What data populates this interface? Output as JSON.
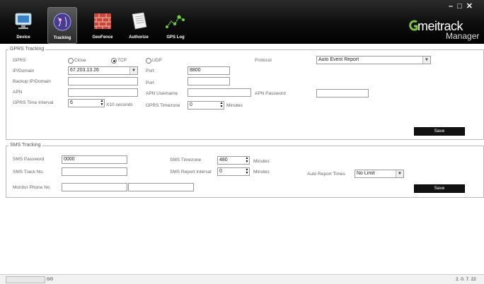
{
  "window": {
    "controls": [
      "–",
      "□",
      "✕"
    ]
  },
  "toolbar": {
    "items": [
      {
        "label": "Device",
        "icon": "monitor-icon"
      },
      {
        "label": "Tracking",
        "icon": "globe-icon",
        "active": true
      },
      {
        "label": "GeoFence",
        "icon": "brick-wall-icon"
      },
      {
        "label": "Authorize",
        "icon": "document-icon"
      },
      {
        "label": "GPS Log",
        "icon": "route-icon"
      }
    ]
  },
  "brand": {
    "name": "meitrack",
    "sub": "Manager",
    "color": "#7ec242"
  },
  "gprs": {
    "legend": "GPRS Tracking",
    "gprs_label": "GPRS",
    "modes": [
      "Close",
      "TCP",
      "UDP"
    ],
    "selected_mode": "TCP",
    "ip_label": "IP/Domain",
    "ip_value": "67.203.13.26",
    "port_label": "Port",
    "port_value": "8800",
    "backup_label": "Backup IP/Domain",
    "backup_value": "",
    "port2_label": "Port",
    "port2_value": "",
    "apn_label": "APN",
    "apn_value": "",
    "apn_user_label": "APN Username",
    "apn_user_value": "",
    "apn_pass_label": "APN Password",
    "apn_pass_value": "",
    "interval_label": "GPRS Time Interval",
    "interval_value": "6",
    "interval_unit": "X10 seconds",
    "timezone_label": "GPRS Timezone",
    "timezone_value": "0",
    "timezone_unit": "Minutes",
    "protocol_label": "Protocol",
    "protocol_value": "Auto Event Report",
    "save_label": "Save"
  },
  "sms": {
    "legend": "SMS Tracking",
    "password_label": "SMS Password",
    "password_value": "0000",
    "track_label": "SMS Track No.",
    "track_value": "",
    "monitor_label": "Monitor Phone No.",
    "monitor_value1": "",
    "monitor_value2": "",
    "timezone_label": "SMS Timezone",
    "timezone_value": "480",
    "timezone_unit": "Minutes",
    "report_label": "SMS Report Interval",
    "report_value": "0",
    "report_unit": "Minutes",
    "auto_label": "Auto Report Times",
    "auto_value": "No Limit",
    "save_label": "Save"
  },
  "status": {
    "progress": "0/0",
    "version": "2. 0. 7. 22"
  }
}
